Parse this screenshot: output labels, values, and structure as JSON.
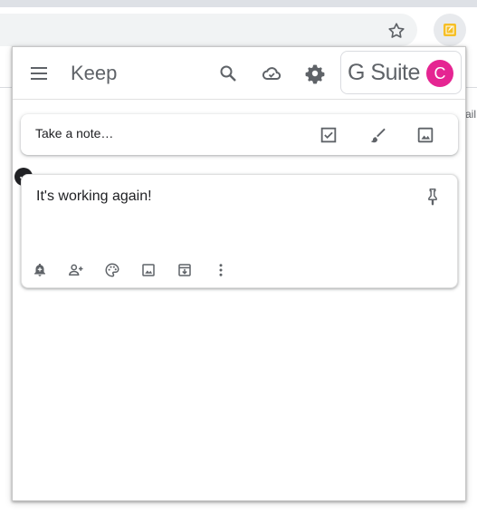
{
  "app": {
    "title": "Keep"
  },
  "background": {
    "partial_text": "ail"
  },
  "gsuite": {
    "label": "G Suite",
    "avatar_initial": "C"
  },
  "take_note": {
    "placeholder": "Take a note…"
  },
  "notes": [
    {
      "title": "It's working again!",
      "selected": true
    }
  ],
  "icons": {
    "header": [
      "menu-icon",
      "search-icon",
      "cloud-sync-icon",
      "settings-icon"
    ],
    "take_note": [
      "checkbox-icon",
      "brush-icon",
      "image-icon"
    ],
    "note_toolbar": [
      "reminder-icon",
      "collaborator-icon",
      "palette-icon",
      "image-icon",
      "archive-icon",
      "more-icon"
    ]
  },
  "colors": {
    "avatar": "#e52592",
    "keep_yellow": "#f6bf26",
    "icon": "#5f6368"
  }
}
